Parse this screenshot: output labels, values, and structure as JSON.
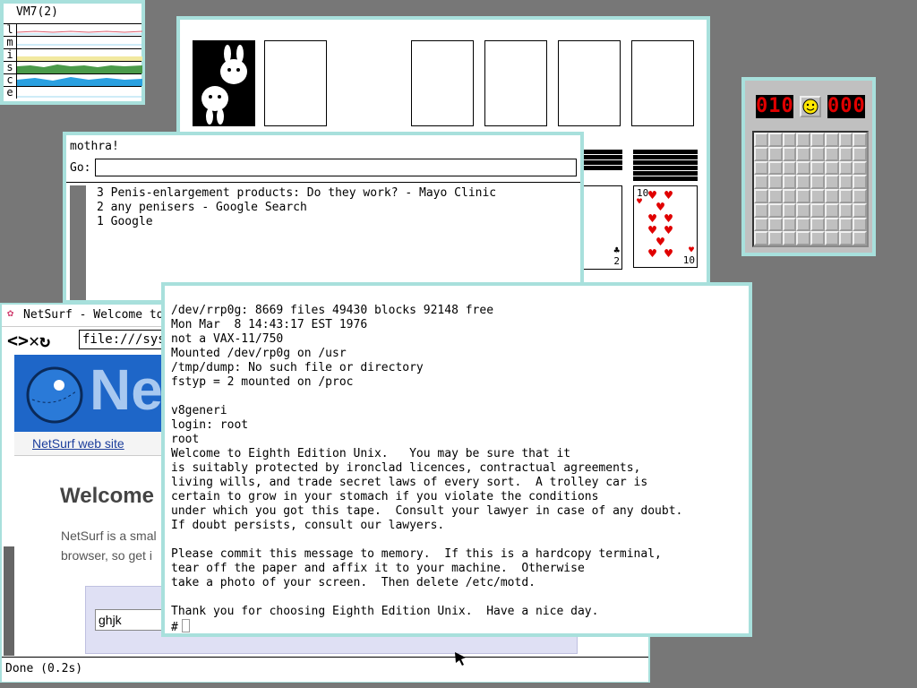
{
  "vmstat": {
    "title": "VM7(2)",
    "rows": [
      "l",
      "m",
      "i",
      "s",
      "c",
      "e"
    ]
  },
  "solitaire": {
    "tableau": [
      {
        "rank": "2",
        "suit": "clubs",
        "color": "#000000"
      },
      {
        "rank": "10",
        "suit": "hearts",
        "color": "#e00000"
      }
    ]
  },
  "minesweeper": {
    "mines_left": "010",
    "timer": "000",
    "face": "smiley-face-icon",
    "grid_size": 8
  },
  "mothra": {
    "title": "mothra!",
    "go_label": "Go:",
    "go_value": "",
    "history": [
      "3 Penis-enlargement products: Do they work? - Mayo Clinic",
      "2 any penisers - Google Search",
      "1 Google"
    ]
  },
  "netsurf": {
    "title": "NetSurf - Welcome to",
    "url": "file:///sys/",
    "logo_text": "Net",
    "link_label": "NetSurf web site",
    "heading": "Welcome",
    "para_line1": "NetSurf is a smal",
    "para_line2": "browser, so get i",
    "search_value": "ghjk",
    "status": "Done (0.2s)"
  },
  "console": {
    "lines": [
      "/dev/rrp0g: 8669 files 49430 blocks 92148 free",
      "Mon Mar  8 14:43:17 EST 1976",
      "not a VAX-11/750",
      "Mounted /dev/rp0g on /usr",
      "/tmp/dump: No such file or directory",
      "fstyp = 2 mounted on /proc",
      "",
      "v8generi",
      "login: root",
      "root",
      "Welcome to Eighth Edition Unix.   You may be sure that it",
      "is suitably protected by ironclad licences, contractual agreements,",
      "living wills, and trade secret laws of every sort.  A trolley car is",
      "certain to grow in your stomach if you violate the conditions",
      "under which you got this tape.  Consult your lawyer in case of any doubt.",
      "If doubt persists, consult our lawyers.",
      "",
      "Please commit this message to memory.  If this is a hardcopy terminal,",
      "tear off the paper and affix it to your machine.  Otherwise",
      "take a photo of your screen.  Then delete /etc/motd.",
      "",
      "Thank you for choosing Eighth Edition Unix.  Have a nice day."
    ],
    "prompt": "#"
  },
  "colors": {
    "desktop": "#777777",
    "window_border": "#a8e0dc",
    "netsurf_blue": "#1e66c8",
    "link_blue": "#1c3e9c"
  }
}
